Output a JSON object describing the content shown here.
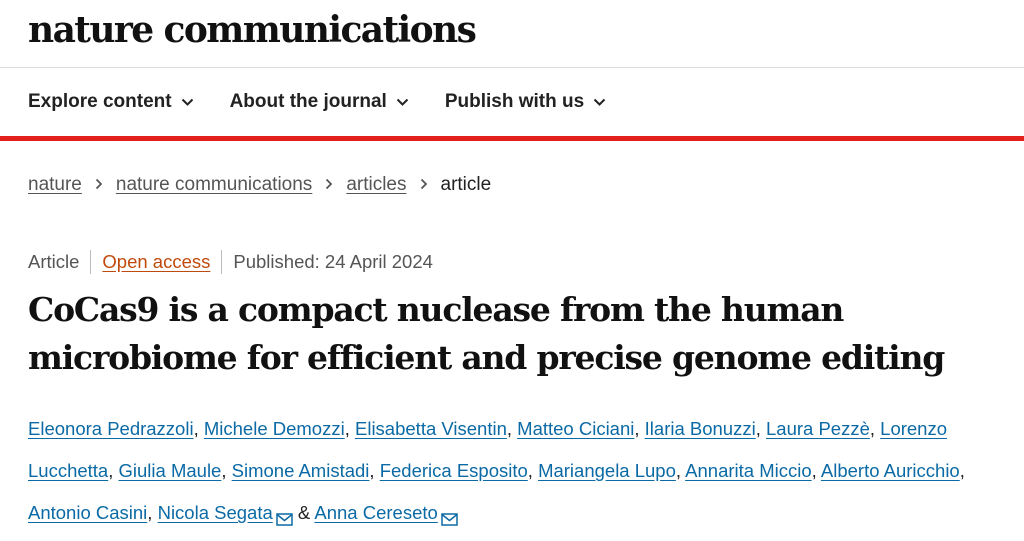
{
  "header": {
    "logo": "nature communications"
  },
  "nav": {
    "items": [
      {
        "label": "Explore content"
      },
      {
        "label": "About the journal"
      },
      {
        "label": "Publish with us"
      }
    ]
  },
  "breadcrumb": {
    "items": [
      "nature",
      "nature communications",
      "articles"
    ],
    "current": "article"
  },
  "meta": {
    "type": "Article",
    "access": "Open access",
    "published": "Published: 24 April 2024"
  },
  "article": {
    "title_line1": "CoCas9 is a compact nuclease from the human",
    "title_line2": "microbiome for efficient and precise genome editing"
  },
  "authors": {
    "list": [
      "Eleonora Pedrazzoli",
      "Michele Demozzi",
      "Elisabetta Visentin",
      "Matteo Ciciani",
      "Ilaria Bonuzzi",
      "Laura Pezzè",
      "Lorenzo Lucchetta",
      "Giulia Maule",
      "Simone Amistadi",
      "Federica Esposito",
      "Mariangela Lupo",
      "Annarita Miccio",
      "Alberto Auricchio",
      "Antonio Casini",
      "Nicola Segata",
      "Anna Cereseto"
    ],
    "separator": ", ",
    "conjunction": " & "
  },
  "colors": {
    "accent_red": "#e3201b",
    "author_link": "#0b6aa5",
    "open_access": "#c04a0d"
  },
  "icons": {
    "nav_chevron": "chevron-down-icon",
    "author_contact": "mail-icon"
  }
}
